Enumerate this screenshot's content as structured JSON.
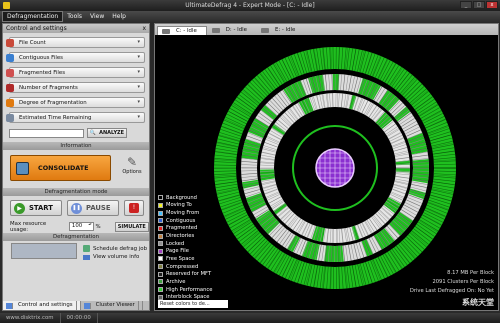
{
  "window": {
    "title": "UltimateDefrag 4 - Expert Mode - [C: - Idle]"
  },
  "menu": [
    "Defragmentation",
    "Tools",
    "View",
    "Help"
  ],
  "left": {
    "header": "Control and settings",
    "stats": [
      {
        "label": "File Count",
        "icon": "files-icon",
        "color": "#c94a3a"
      },
      {
        "label": "Contiguous Files",
        "icon": "contiguous-icon",
        "color": "#3a7fd0"
      },
      {
        "label": "Fragmented Files",
        "icon": "fragmented-icon",
        "color": "#d05050"
      },
      {
        "label": "Number of Fragments",
        "icon": "fragments-icon",
        "color": "#b02a2a"
      },
      {
        "label": "Degree of Fragmentation",
        "icon": "degree-icon",
        "color": "#e07a10"
      },
      {
        "label": "Estimated Time Remaining",
        "icon": "clock-icon",
        "color": "#7a8aa0"
      }
    ],
    "analyze_label": "ANALYZE",
    "information_label": "Information",
    "consolidate_label": "CONSOLIDATE",
    "options_label": "Options",
    "mode_label": "Defragmentation mode",
    "start_label": "START",
    "pause_label": "PAUSE",
    "stop_symbol": "!",
    "resource_label": "Max resource usage:",
    "resource_value": "100",
    "resource_unit": "%",
    "simulate_label": "SIMULATE",
    "defrag_label": "Defragmentation",
    "schedule_label": "Schedule defrag job",
    "volume_label": "View volume info",
    "tab_control": "Control and settings",
    "tab_cluster": "Cluster Viewer"
  },
  "map": {
    "tabs": [
      "C: - Idle",
      "D: - Idle",
      "E: - Idle"
    ],
    "legend": [
      {
        "label": "Background",
        "color": "#000000"
      },
      {
        "label": "Moving To",
        "color": "#f0f020"
      },
      {
        "label": "Moving From",
        "color": "#40c0ff"
      },
      {
        "label": "Contiguous",
        "color": "#3060d0"
      },
      {
        "label": "Fragmented",
        "color": "#e02020"
      },
      {
        "label": "Directories",
        "color": "#c08040"
      },
      {
        "label": "Locked",
        "color": "#909090"
      },
      {
        "label": "Page File",
        "color": "#a040c0"
      },
      {
        "label": "Free Space",
        "color": "#ffffff"
      },
      {
        "label": "Compressed",
        "color": "#808040"
      },
      {
        "label": "Reserved for MFT",
        "color": "#202020"
      },
      {
        "label": "Archive",
        "color": "#40a040"
      },
      {
        "label": "High Performance",
        "color": "#30d030"
      },
      {
        "label": "Interblock Space",
        "color": "#606060"
      }
    ],
    "stats": [
      "8.17 MB Per Block",
      "2091 Clusters Per Block",
      "Drive Last Defragged On: No Yet"
    ],
    "reset_label": "Reset colors to de..."
  },
  "status": {
    "site": "www.disktrix.com",
    "time": "00:00:00"
  },
  "watermark": "系统天堂"
}
